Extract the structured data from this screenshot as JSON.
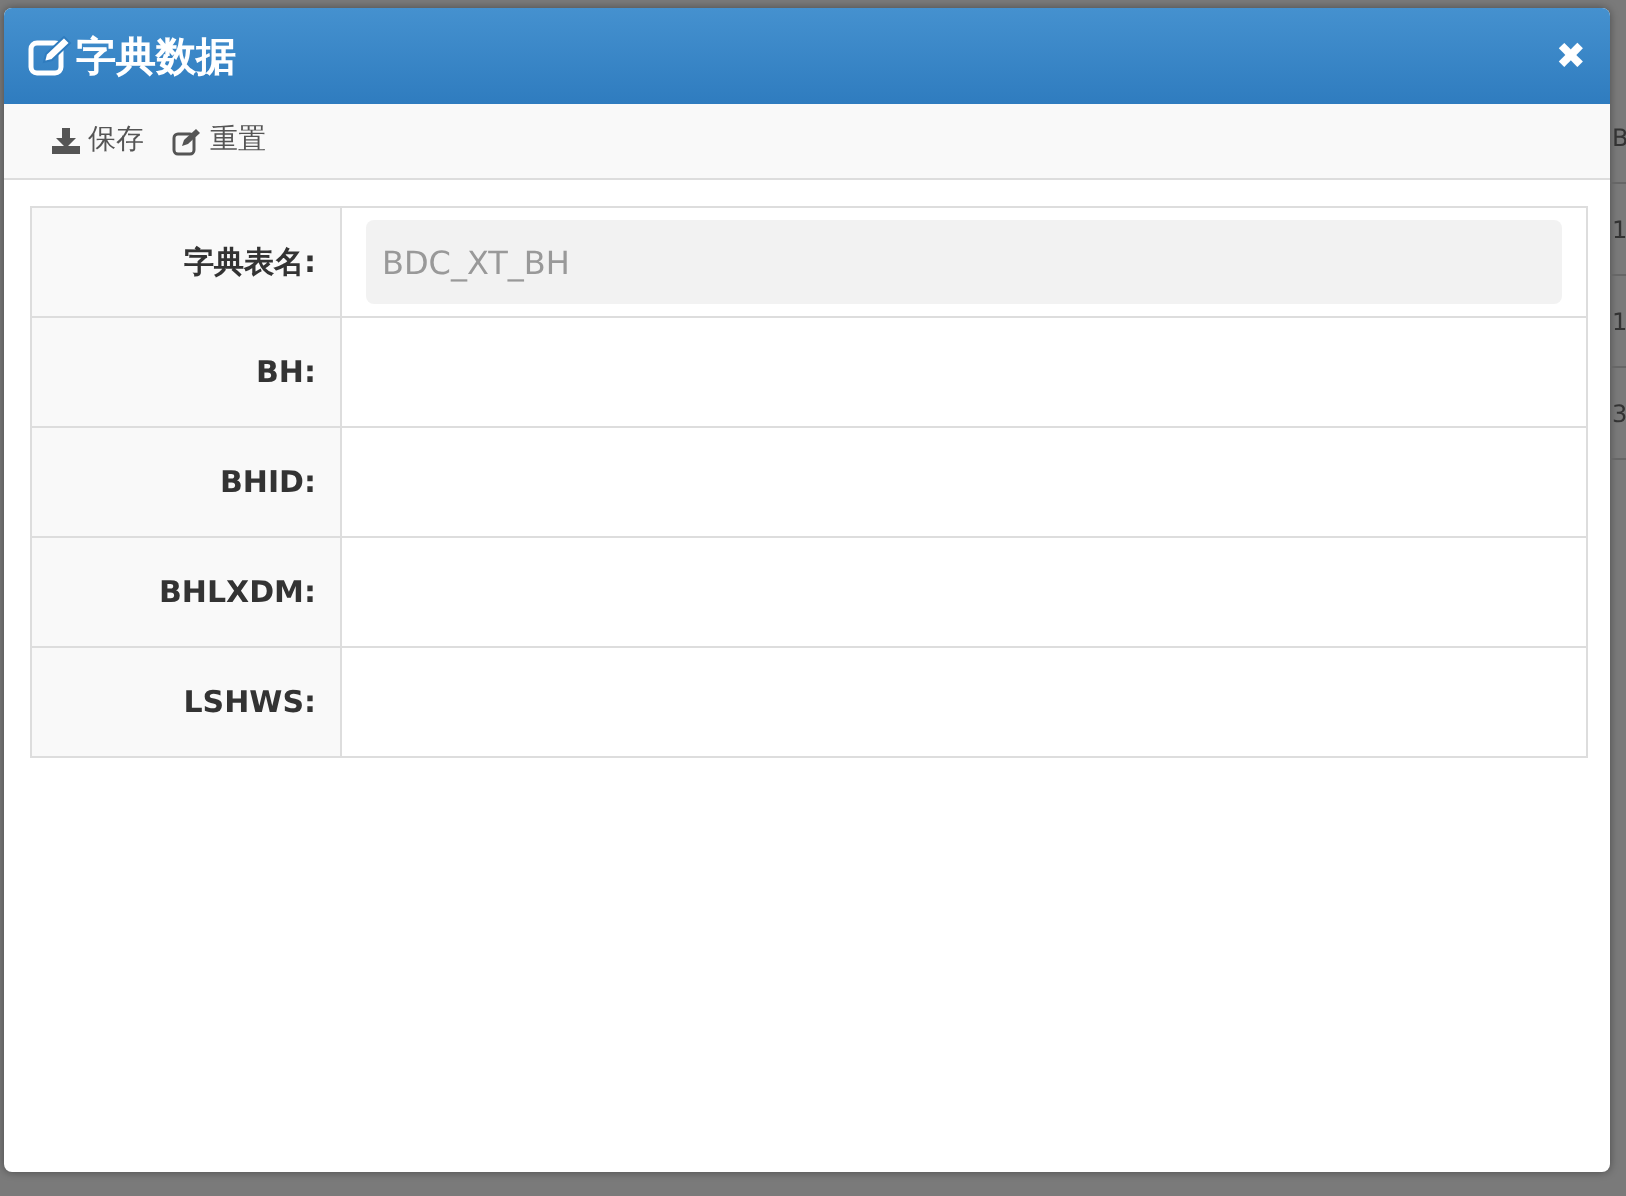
{
  "dialog": {
    "title": "字典数据",
    "close": "✖"
  },
  "toolbar": [
    {
      "kind": "save",
      "label": "保存"
    },
    {
      "kind": "reset",
      "label": "重置"
    }
  ],
  "form": {
    "rows": [
      {
        "label": "字典表名:",
        "value": "BDC_XT_BH",
        "disabled": true
      },
      {
        "label": "BH:",
        "value": "",
        "disabled": false
      },
      {
        "label": "BHID:",
        "value": "",
        "disabled": false
      },
      {
        "label": "BHLXDM:",
        "value": "",
        "disabled": false
      },
      {
        "label": "LSHWS:",
        "value": "",
        "disabled": false
      }
    ]
  },
  "background_column": [
    "B",
    "1",
    "1",
    "3"
  ]
}
